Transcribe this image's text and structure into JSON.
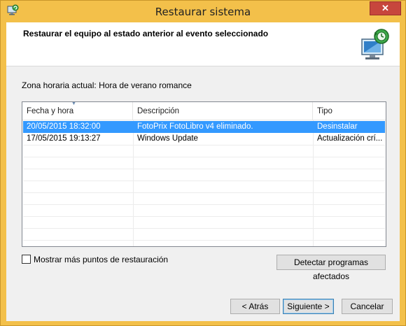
{
  "window": {
    "title": "Restaurar sistema",
    "close_label": "✕"
  },
  "header": {
    "title": "Restaurar el equipo al estado anterior al evento seleccionado"
  },
  "timezone": "Zona horaria actual: Hora de verano romance",
  "table": {
    "columns": [
      "Fecha y hora",
      "Descripción",
      "Tipo"
    ],
    "rows": [
      {
        "date": "20/05/2015 18:32:00",
        "description": "FotoPrix FotoLibro v4 eliminado.",
        "type": "Desinstalar",
        "selected": true
      },
      {
        "date": "17/05/2015 19:13:27",
        "description": "Windows Update",
        "type": "Actualización crí...",
        "selected": false
      }
    ]
  },
  "more_points": {
    "label": "Mostrar más puntos de restauración",
    "checked": false
  },
  "buttons": {
    "detect": "Detectar programas afectados",
    "back": "< Atrás",
    "next": "Siguiente >",
    "cancel": "Cancelar"
  },
  "colors": {
    "frame": "#f3c04a",
    "selection": "#3399ff",
    "close": "#c7463d"
  },
  "icons": {
    "app": "system-restore-icon",
    "header": "monitor-restore-icon",
    "close": "close-icon"
  }
}
